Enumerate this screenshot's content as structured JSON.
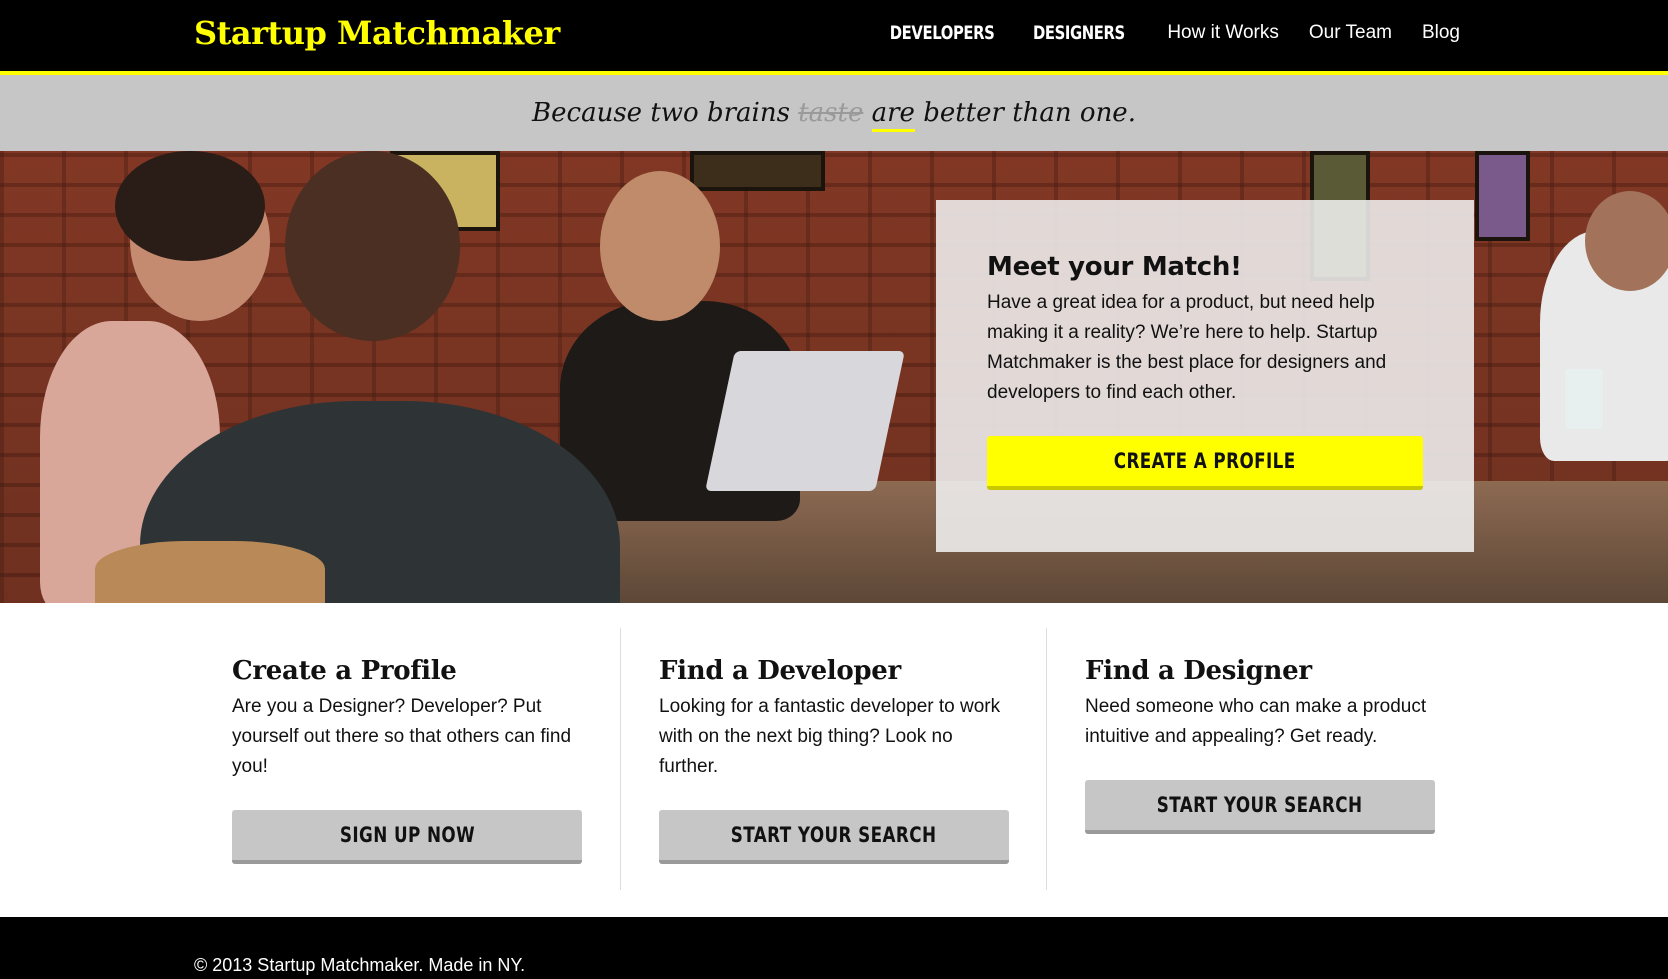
{
  "nav": {
    "brand": "Startup Matchmaker",
    "links": [
      "DEVELOPERS",
      "DESIGNERS",
      "How it Works",
      "Our Team",
      "Blog"
    ]
  },
  "tagline": {
    "before": "Because two brains ",
    "struck": "taste",
    "underlined": "are",
    "after": " better than one."
  },
  "hero": {
    "title": "Meet your Match!",
    "body": "Have a great idea for a product, but need help making it a reality? We’re here to help. Startup Matchmaker is the best place for designers and developers to find each other.",
    "cta": "CREATE A PROFILE"
  },
  "features": [
    {
      "title": "Create a Profile",
      "body": "Are you a Designer? Developer? Put yourself out there so that others can find you!",
      "button": "SIGN UP NOW"
    },
    {
      "title": "Find a Developer",
      "body": "Looking for a fantastic developer to work with on the next big thing? Look no further.",
      "button": "START YOUR SEARCH"
    },
    {
      "title": "Find a Designer",
      "body": "Need someone who can make a product intuitive and appealing? Get ready.",
      "button": "START YOUR SEARCH"
    }
  ],
  "footer": {
    "text": "© 2013 Startup Matchmaker. Made in NY."
  },
  "colors": {
    "accent": "#ffff00",
    "nav_bg": "#000000",
    "tagline_bg": "#c6c6c6",
    "button_grey": "#c6c6c6"
  }
}
